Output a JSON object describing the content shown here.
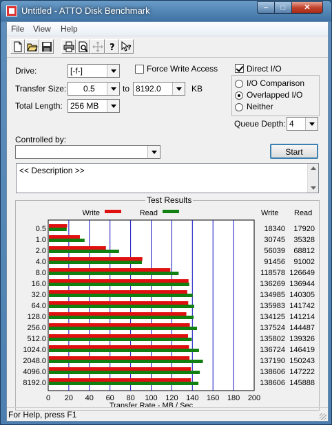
{
  "window": {
    "title": "Untitled - ATTO Disk Benchmark"
  },
  "menu": [
    "File",
    "View",
    "Help"
  ],
  "toolbar": [
    "new-icon",
    "open-icon",
    "save-icon",
    "print-icon",
    "print-preview-icon",
    "move-icon",
    "help-icon",
    "context-help-icon"
  ],
  "settings": {
    "drive_label": "Drive:",
    "drive_value": "[-f-]",
    "transfer_label": "Transfer Size:",
    "transfer_from": "0.5",
    "to_label": "to",
    "transfer_to": "8192.0",
    "kb_label": "KB",
    "total_label": "Total Length:",
    "total_value": "256 MB",
    "force_write": "Force Write Access",
    "direct_io": "Direct I/O",
    "io_comparison": "I/O Comparison",
    "overlapped_io": "Overlapped I/O",
    "neither": "Neither",
    "queue_label": "Queue Depth:",
    "queue_value": "4",
    "controlled_label": "Controlled by:",
    "controlled_value": "",
    "start_label": "Start",
    "description": "<< Description >>"
  },
  "results": {
    "title": "Test Results",
    "write_legend": "Write",
    "read_legend": "Read",
    "write_col": "Write",
    "read_col": "Read"
  },
  "chart_data": {
    "type": "bar",
    "orientation": "horizontal",
    "categories": [
      "0.5",
      "1.0",
      "2.0",
      "4.0",
      "8.0",
      "16.0",
      "32.0",
      "64.0",
      "128.0",
      "256.0",
      "512.0",
      "1024.0",
      "2048.0",
      "4096.0",
      "8192.0"
    ],
    "series": [
      {
        "name": "Write",
        "color": "#e01010",
        "values": [
          18340,
          30745,
          56039,
          91456,
          118578,
          136269,
          134985,
          135983,
          134125,
          137524,
          135802,
          136724,
          137190,
          138606,
          138606
        ]
      },
      {
        "name": "Read",
        "color": "#108010",
        "values": [
          17920,
          35328,
          68812,
          91002,
          126649,
          136944,
          140305,
          141742,
          141214,
          144487,
          139326,
          146419,
          150243,
          147222,
          145888
        ]
      }
    ],
    "xlabel": "Transfer Rate - MB / Sec",
    "xlim": [
      0,
      200
    ],
    "xticks": [
      0,
      20,
      40,
      60,
      80,
      100,
      120,
      140,
      160,
      180,
      200
    ],
    "grid": true,
    "legend": "top"
  },
  "status": {
    "text": "For Help, press F1"
  }
}
